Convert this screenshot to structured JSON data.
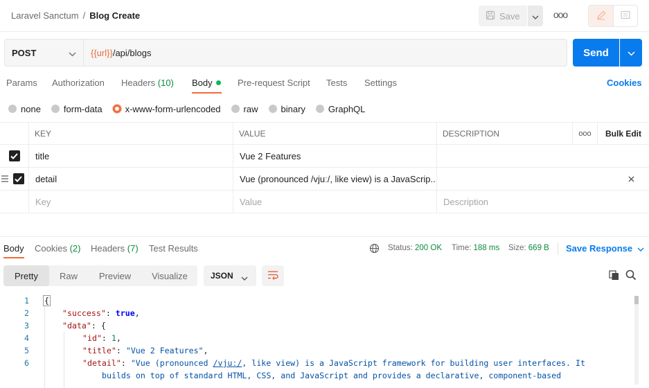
{
  "header": {
    "breadcrumb_parent": "Laravel Sanctum",
    "breadcrumb_sep": "/",
    "breadcrumb_current": "Blog Create",
    "save_label": "Save",
    "more_label": "ooo"
  },
  "request": {
    "method": "POST",
    "url_var": "{{url}}",
    "url_path": "/api/blogs",
    "send_label": "Send"
  },
  "req_tabs": {
    "params": "Params",
    "authorization": "Authorization",
    "headers": "Headers",
    "headers_count": "(10)",
    "body": "Body",
    "prerequest": "Pre-request Script",
    "tests": "Tests",
    "settings": "Settings",
    "cookies": "Cookies"
  },
  "body_types": {
    "none": "none",
    "form_data": "form-data",
    "urlencoded": "x-www-form-urlencoded",
    "raw": "raw",
    "binary": "binary",
    "graphql": "GraphQL",
    "selected": "x-www-form-urlencoded"
  },
  "params_table": {
    "headers": {
      "key": "KEY",
      "value": "VALUE",
      "description": "DESCRIPTION",
      "more": "ooo",
      "bulk_edit": "Bulk Edit"
    },
    "rows": [
      {
        "key": "title",
        "value": "Vue 2 Features",
        "description": ""
      },
      {
        "key": "detail",
        "value": "Vue (pronounced /vjuː/, like view) is a JavaScrip...",
        "description": ""
      }
    ],
    "placeholder": {
      "key": "Key",
      "value": "Value",
      "description": "Description"
    }
  },
  "response": {
    "tabs": {
      "body": "Body",
      "cookies": "Cookies",
      "cookies_count": "(2)",
      "headers": "Headers",
      "headers_count": "(7)",
      "test_results": "Test Results"
    },
    "status_label": "Status:",
    "status_value": "200 OK",
    "time_label": "Time:",
    "time_value": "188 ms",
    "size_label": "Size:",
    "size_value": "669 B",
    "save_response": "Save Response",
    "views": {
      "pretty": "Pretty",
      "raw": "Raw",
      "preview": "Preview",
      "visualize": "Visualize"
    },
    "format": "JSON",
    "code_line_numbers": [
      "1",
      "2",
      "3",
      "4",
      "5",
      "6"
    ],
    "json": {
      "open_brace": "{",
      "success_key": "\"success\"",
      "success_val": "true",
      "data_key": "\"data\"",
      "data_open": "{",
      "id_key": "\"id\"",
      "id_val": "1",
      "title_key": "\"title\"",
      "title_val": "\"Vue 2 Features\"",
      "detail_key": "\"detail\"",
      "detail_pre": "\"Vue (pronounced ",
      "detail_ipa": "/vjuː/",
      "detail_line1_post": ", like view) is a JavaScript framework for building user interfaces. It",
      "detail_line2": "builds on top of standard HTML, CSS, and JavaScript and provides a declarative, component-based"
    }
  },
  "colors": {
    "accent": "#f26b3a",
    "send_blue": "#097bed",
    "status_green": "#0b8a3e"
  },
  "icons": {
    "save": "save-disk-icon",
    "edit": "pencil-icon",
    "comments": "comment-icon",
    "globe": "globe-icon",
    "copy": "copy-icon",
    "search": "search-icon",
    "wrap": "wrap-lines-icon"
  }
}
